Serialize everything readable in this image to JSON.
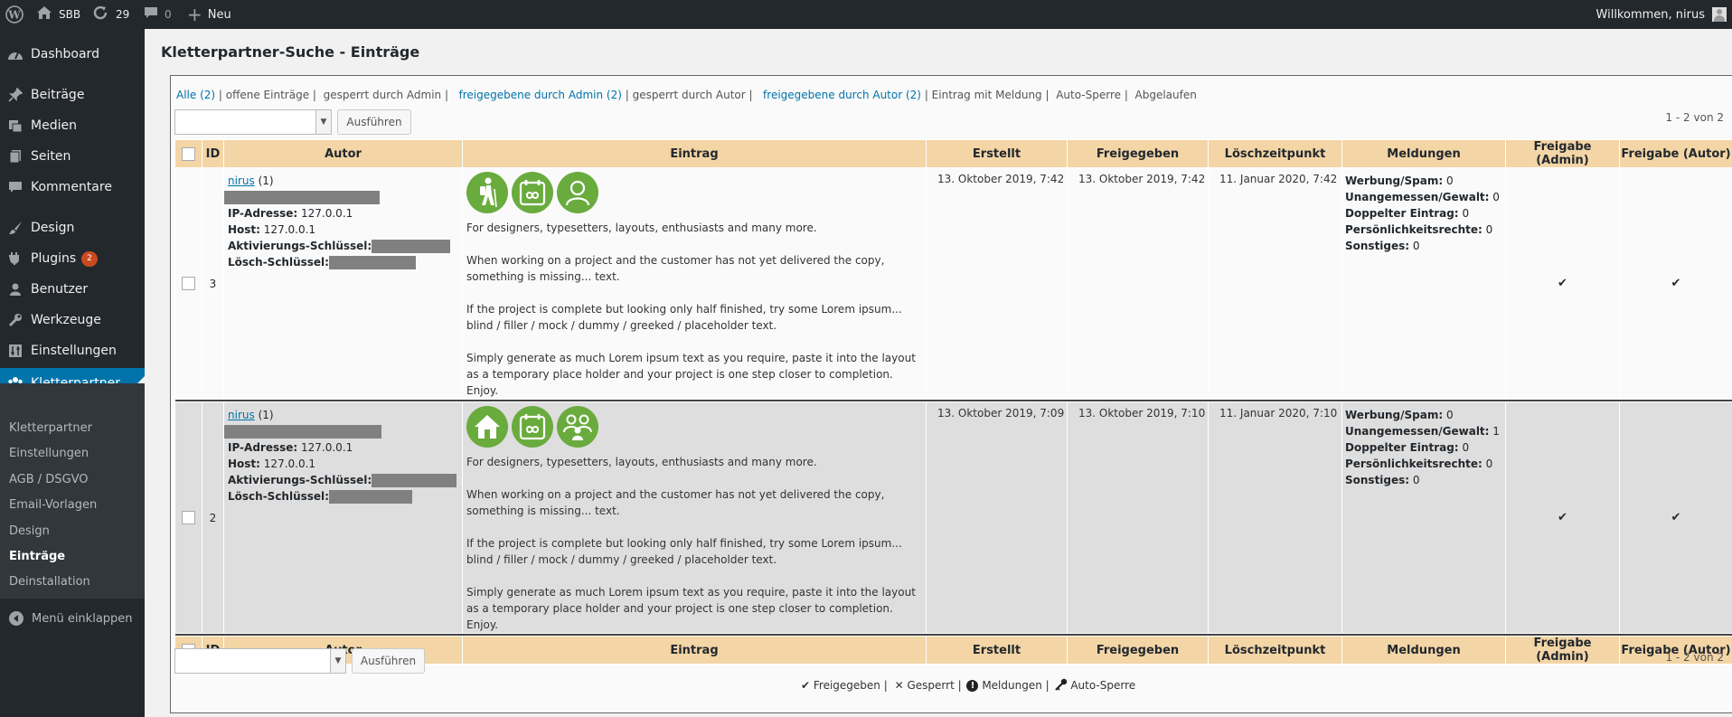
{
  "adminbar": {
    "site": "SBB",
    "updates": "29",
    "comments": "0",
    "new": "Neu",
    "welcome": "Willkommen, nirus"
  },
  "menu": [
    {
      "label": "Dashboard",
      "icon": "dashboard-icon"
    },
    {
      "label": "Beiträge",
      "icon": "pin-icon"
    },
    {
      "label": "Medien",
      "icon": "media-icon"
    },
    {
      "label": "Seiten",
      "icon": "pages-icon"
    },
    {
      "label": "Kommentare",
      "icon": "comment-icon"
    },
    {
      "label": "Design",
      "icon": "brush-icon"
    },
    {
      "label": "Plugins",
      "icon": "plugin-icon",
      "badge": "2"
    },
    {
      "label": "Benutzer",
      "icon": "user-icon"
    },
    {
      "label": "Werkzeuge",
      "icon": "wrench-icon"
    },
    {
      "label": "Einstellungen",
      "icon": "settings-icon"
    },
    {
      "label": "Kletterpartner",
      "icon": "group-icon"
    }
  ],
  "submenu": [
    "Kletterpartner",
    "Einstellungen",
    "AGB / DSGVO",
    "Email-Vorlagen",
    "Design",
    "Einträge",
    "Deinstallation"
  ],
  "collapse": "Menü einklappen",
  "page_title": "Kletterpartner-Suche - Einträge",
  "filters": {
    "all": "Alle (2)",
    "open": "offene Einträge",
    "locked_admin": "gesperrt durch Admin",
    "approved_admin": "freigegebene durch Admin (2)",
    "locked_author": "gesperrt durch Autor",
    "approved_author": "freigegebene durch Autor (2)",
    "reported": "Eintrag mit Meldung",
    "auto_lock": "Auto-Sperre",
    "expired": "Abgelaufen"
  },
  "apply_label": "Ausführen",
  "count": "1 - 2 von 2",
  "columns": [
    "ID",
    "Autor",
    "Eintrag",
    "Erstellt",
    "Freigegeben",
    "Löschzeitpunkt",
    "Meldungen",
    "Freigabe (Admin)",
    "Freigabe (Autor)"
  ],
  "author_labels": {
    "ip": "IP-Adresse:",
    "host": "Host:",
    "activation": "Aktivierungs-Schlüssel:",
    "delete": "Lösch-Schlüssel:"
  },
  "report_labels": {
    "spam": "Werbung/Spam:",
    "abuse": "Unangemessen/Gewalt:",
    "duplicate": "Doppelter Eintrag:",
    "privacy": "Persönlichkeitsrechte:",
    "other": "Sonstiges:"
  },
  "rows": [
    {
      "id": "3",
      "author": "nirus",
      "author_count": "(1)",
      "ip": "127.0.0.1",
      "host": "127.0.0.1",
      "icons": [
        "hiker-icon",
        "calendar-infinity-icon",
        "person-icon"
      ],
      "text": [
        "For designers, typesetters, layouts, enthusiasts and many more.",
        "When working on a project and the customer has not yet delivered the copy, something is missing... text.",
        "If the project is complete but looking only half finished, try some Lorem ipsum... blind / filler / mock / dummy / greeked / placeholder text.",
        "Simply generate as much Lorem ipsum text as you require, paste it into the layout as a temporary place holder and your project is one step closer to completion. Enjoy."
      ],
      "created": "13. Oktober 2019, 7:42",
      "approved": "13. Oktober 2019, 7:42",
      "delete_at": "11. Januar 2020, 7:42",
      "reports": {
        "spam": "0",
        "abuse": "0",
        "duplicate": "0",
        "privacy": "0",
        "other": "0"
      },
      "admin_ok": "✔",
      "author_ok": "✔"
    },
    {
      "id": "2",
      "author": "nirus",
      "author_count": "(1)",
      "ip": "127.0.0.1",
      "host": "127.0.0.1",
      "icons": [
        "house-icon",
        "calendar-infinity-icon",
        "family-icon"
      ],
      "text": [
        "For designers, typesetters, layouts, enthusiasts and many more.",
        "When working on a project and the customer has not yet delivered the copy, something is missing... text.",
        "If the project is complete but looking only half finished, try some Lorem ipsum... blind / filler / mock / dummy / greeked / placeholder text.",
        "Simply generate as much Lorem ipsum text as you require, paste it into the layout as a temporary place holder and your project is one step closer to completion. Enjoy."
      ],
      "created": "13. Oktober 2019, 7:09",
      "approved": "13. Oktober 2019, 7:10",
      "delete_at": "11. Januar 2020, 7:10",
      "reports": {
        "spam": "0",
        "abuse": "1",
        "duplicate": "0",
        "privacy": "0",
        "other": "0"
      },
      "admin_ok": "✔",
      "author_ok": "✔"
    }
  ],
  "legend": {
    "approved": "Freigegeben |",
    "locked": "Gesperrt |",
    "reports": "Meldungen |",
    "auto_lock": "Auto-Sperre"
  },
  "colors": {
    "accent": "#0073aa",
    "header": "#f3d5a6",
    "icon": "#6aab3e"
  }
}
